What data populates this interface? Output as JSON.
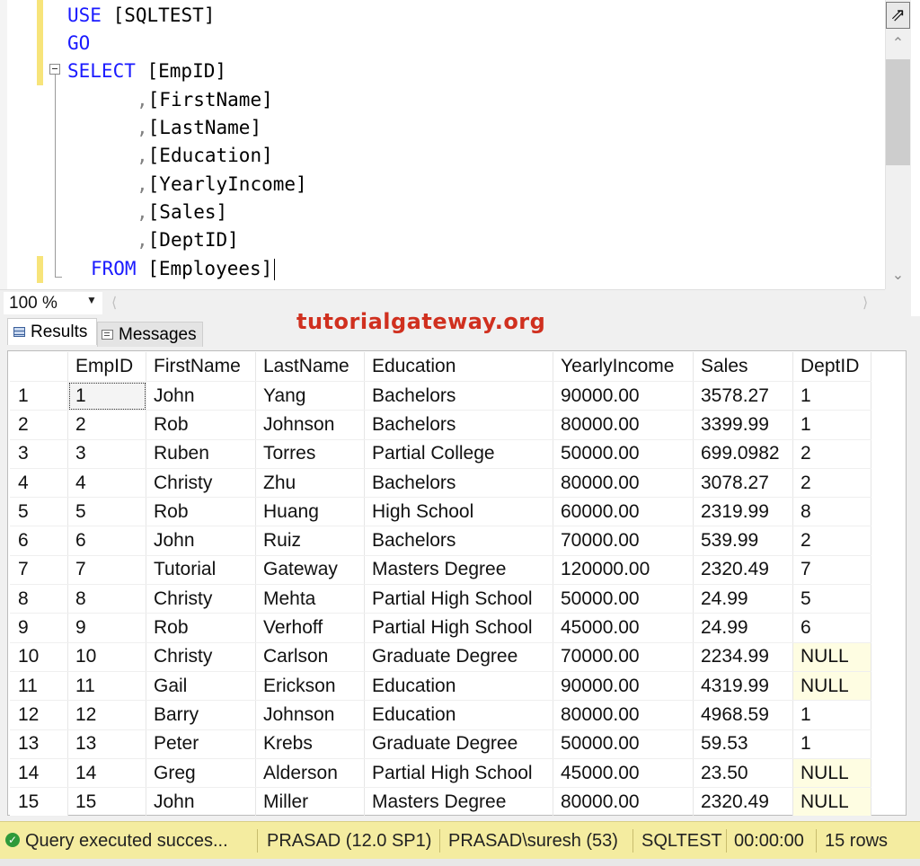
{
  "editor": {
    "lines": [
      {
        "kw": "USE",
        "rest": " [SQLTEST]"
      },
      {
        "kw": "GO",
        "rest": ""
      },
      {
        "kw": "SELECT",
        "rest": " [EmpID]"
      },
      {
        "kw": "",
        "rest": "[FirstName]"
      },
      {
        "kw": "",
        "rest": "[LastName]"
      },
      {
        "kw": "",
        "rest": "[Education]"
      },
      {
        "kw": "",
        "rest": "[YearlyIncome]"
      },
      {
        "kw": "",
        "rest": "[Sales]"
      },
      {
        "kw": "",
        "rest": "[DeptID]"
      },
      {
        "kw": "FROM",
        "rest": " [Employees]"
      }
    ],
    "comma": ","
  },
  "zoom": {
    "value": "100 %"
  },
  "watermark": "tutorialgateway.org",
  "tabs": {
    "results": "Results",
    "messages": "Messages"
  },
  "grid": {
    "columns": [
      "EmpID",
      "FirstName",
      "LastName",
      "Education",
      "YearlyIncome",
      "Sales",
      "DeptID"
    ],
    "rows": [
      [
        "1",
        "1",
        "John",
        "Yang",
        "Bachelors",
        "90000.00",
        "3578.27",
        "1"
      ],
      [
        "2",
        "2",
        "Rob",
        "Johnson",
        "Bachelors",
        "80000.00",
        "3399.99",
        "1"
      ],
      [
        "3",
        "3",
        "Ruben",
        "Torres",
        "Partial College",
        "50000.00",
        "699.0982",
        "2"
      ],
      [
        "4",
        "4",
        "Christy",
        "Zhu",
        "Bachelors",
        "80000.00",
        "3078.27",
        "2"
      ],
      [
        "5",
        "5",
        "Rob",
        "Huang",
        "High School",
        "60000.00",
        "2319.99",
        "8"
      ],
      [
        "6",
        "6",
        "John",
        "Ruiz",
        "Bachelors",
        "70000.00",
        "539.99",
        "2"
      ],
      [
        "7",
        "7",
        "Tutorial",
        "Gateway",
        "Masters Degree",
        "120000.00",
        "2320.49",
        "7"
      ],
      [
        "8",
        "8",
        "Christy",
        "Mehta",
        "Partial High School",
        "50000.00",
        "24.99",
        "5"
      ],
      [
        "9",
        "9",
        "Rob",
        "Verhoff",
        "Partial High School",
        "45000.00",
        "24.99",
        "6"
      ],
      [
        "10",
        "10",
        "Christy",
        "Carlson",
        "Graduate Degree",
        "70000.00",
        "2234.99",
        "NULL"
      ],
      [
        "11",
        "11",
        "Gail",
        "Erickson",
        "Education",
        "90000.00",
        "4319.99",
        "NULL"
      ],
      [
        "12",
        "12",
        "Barry",
        "Johnson",
        "Education",
        "80000.00",
        "4968.59",
        "1"
      ],
      [
        "13",
        "13",
        "Peter",
        "Krebs",
        "Graduate Degree",
        "50000.00",
        "59.53",
        "1"
      ],
      [
        "14",
        "14",
        "Greg",
        "Alderson",
        "Partial High School",
        "45000.00",
        "23.50",
        "NULL"
      ],
      [
        "15",
        "15",
        "John",
        "Miller",
        "Masters Degree",
        "80000.00",
        "2320.49",
        "NULL"
      ]
    ]
  },
  "status": {
    "message": "Query executed succes...",
    "server": "PRASAD (12.0 SP1)",
    "user": "PRASAD\\suresh (53)",
    "database": "SQLTEST",
    "elapsed": "00:00:00",
    "rows": "15 rows"
  },
  "colors": {
    "keyword": "#1a1aff",
    "status_bar": "#f4eca0",
    "watermark": "#d0301f"
  }
}
